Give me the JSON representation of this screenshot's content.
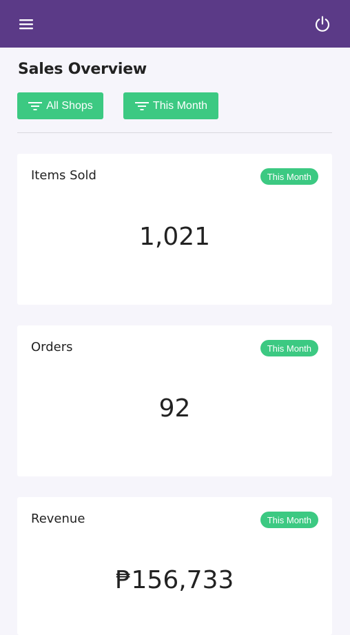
{
  "header": {
    "menu_icon": "hamburger-menu-icon",
    "power_icon": "power-icon",
    "background": "#5b3a87"
  },
  "page": {
    "title": "Sales Overview"
  },
  "filters": {
    "shops_label": "All Shops",
    "period_label": "This Month",
    "filter_icon": "filter-icon",
    "color": "#3cc982"
  },
  "cards": [
    {
      "title": "Items Sold",
      "badge": "This Month",
      "value": "1,021"
    },
    {
      "title": "Orders",
      "badge": "This Month",
      "value": "92"
    },
    {
      "title": "Revenue",
      "badge": "This Month",
      "value": "₱156,733"
    }
  ]
}
